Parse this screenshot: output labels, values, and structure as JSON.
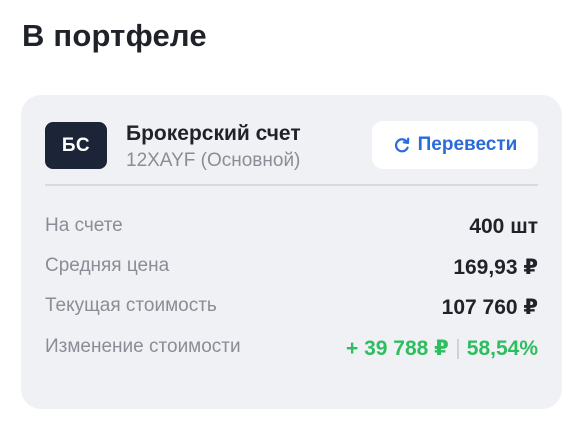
{
  "section": {
    "title": "В портфеле"
  },
  "account": {
    "avatar_text": "БС",
    "name": "Брокерский счет",
    "id_label": "12XAYF (Основной)",
    "transfer_button": {
      "label": "Перевести",
      "icon": "refresh-icon"
    }
  },
  "stats": {
    "on_account": {
      "label": "На счете",
      "value": "400 шт"
    },
    "average_price": {
      "label": "Средняя цена",
      "value": "169,93 ₽"
    },
    "current_value": {
      "label": "Текущая стоимость",
      "value": "107 760 ₽"
    },
    "value_change": {
      "label": "Изменение стоимости",
      "absolute": "+ 39 788 ₽",
      "percent": "58,54%"
    }
  },
  "colors": {
    "accent_blue": "#2b6bd9",
    "positive_green": "#2ebd5f",
    "card_background": "#f0f1f5",
    "avatar_background": "#1b2537"
  }
}
